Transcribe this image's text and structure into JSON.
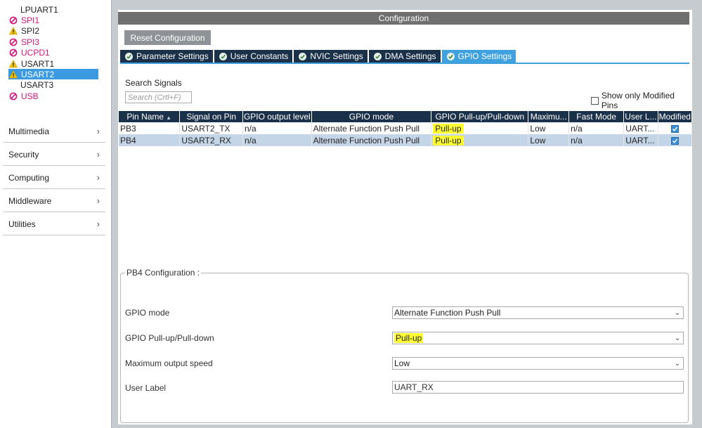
{
  "sidebar": {
    "peripherals": [
      {
        "label": "LPUART1",
        "status": "none",
        "selected": false
      },
      {
        "label": "SPI1",
        "status": "disabled",
        "selected": false
      },
      {
        "label": "SPI2",
        "status": "warning",
        "selected": false
      },
      {
        "label": "SPI3",
        "status": "disabled",
        "selected": false
      },
      {
        "label": "UCPD1",
        "status": "disabled",
        "selected": false
      },
      {
        "label": "USART1",
        "status": "warning",
        "selected": false
      },
      {
        "label": "USART2",
        "status": "warning",
        "selected": true
      },
      {
        "label": "USART3",
        "status": "none",
        "selected": false
      },
      {
        "label": "USB",
        "status": "disabled",
        "selected": false
      }
    ],
    "categories": [
      {
        "label": "Multimedia",
        "icon": "chevron-right-icon"
      },
      {
        "label": "Security",
        "icon": "chevron-right-icon"
      },
      {
        "label": "Computing",
        "icon": "chevron-right-icon"
      },
      {
        "label": "Middleware",
        "icon": "chevron-right-icon"
      },
      {
        "label": "Utilities",
        "icon": "chevron-right-icon"
      }
    ]
  },
  "config": {
    "header": "Configuration",
    "reset_label": "Reset Configuration",
    "tabs": [
      {
        "label": "Parameter Settings",
        "active": false
      },
      {
        "label": "User Constants",
        "active": false
      },
      {
        "label": "NVIC Settings",
        "active": false
      },
      {
        "label": "DMA Settings",
        "active": false
      },
      {
        "label": "GPIO Settings",
        "active": true
      }
    ],
    "search_label": "Search Signals",
    "search_placeholder": "Search (Crtl+F)",
    "show_modified_label": "Show only Modified Pins",
    "show_modified_checked": false
  },
  "table": {
    "columns": [
      "Pin Name",
      "Signal on Pin",
      "GPIO output level",
      "GPIO mode",
      "GPIO Pull-up/Pull-down",
      "Maximu...",
      "Fast Mode",
      "User L...",
      "Modified"
    ],
    "rows": [
      {
        "pin": "PB3",
        "signal": "USART2_TX",
        "level": "n/a",
        "mode": "Alternate Function Push Pull",
        "pull": "Pull-up",
        "speed": "Low",
        "fast": "n/a",
        "label": "UART...",
        "modified": true,
        "selected": false
      },
      {
        "pin": "PB4",
        "signal": "USART2_RX",
        "level": "n/a",
        "mode": "Alternate Function Push Pull",
        "pull": "Pull-up",
        "speed": "Low",
        "fast": "n/a",
        "label": "UART...",
        "modified": true,
        "selected": true
      }
    ]
  },
  "pin_config": {
    "title": "PB4 Configuration :",
    "gpio_mode_label": "GPIO mode",
    "gpio_mode_value": "Alternate Function Push Pull",
    "pull_label": "GPIO Pull-up/Pull-down",
    "pull_value": "Pull-up",
    "speed_label": "Maximum output speed",
    "speed_value": "Low",
    "user_label_label": "User Label",
    "user_label_value": "UART_RX"
  },
  "colors": {
    "tab_dark": "#1a3149",
    "tab_active": "#3fa2df",
    "highlight": "#ffff33",
    "disabled_pink": "#d4147d",
    "warning_yellow": "#f2c200"
  }
}
